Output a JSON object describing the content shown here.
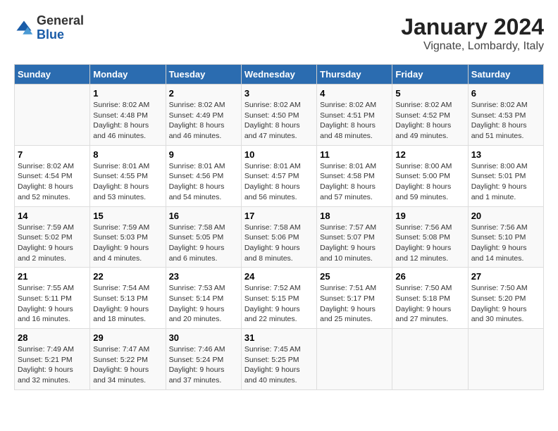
{
  "logo": {
    "general": "General",
    "blue": "Blue"
  },
  "title": "January 2024",
  "subtitle": "Vignate, Lombardy, Italy",
  "days_of_week": [
    "Sunday",
    "Monday",
    "Tuesday",
    "Wednesday",
    "Thursday",
    "Friday",
    "Saturday"
  ],
  "weeks": [
    [
      {
        "day": "",
        "info": ""
      },
      {
        "day": "1",
        "info": "Sunrise: 8:02 AM\nSunset: 4:48 PM\nDaylight: 8 hours\nand 46 minutes."
      },
      {
        "day": "2",
        "info": "Sunrise: 8:02 AM\nSunset: 4:49 PM\nDaylight: 8 hours\nand 46 minutes."
      },
      {
        "day": "3",
        "info": "Sunrise: 8:02 AM\nSunset: 4:50 PM\nDaylight: 8 hours\nand 47 minutes."
      },
      {
        "day": "4",
        "info": "Sunrise: 8:02 AM\nSunset: 4:51 PM\nDaylight: 8 hours\nand 48 minutes."
      },
      {
        "day": "5",
        "info": "Sunrise: 8:02 AM\nSunset: 4:52 PM\nDaylight: 8 hours\nand 49 minutes."
      },
      {
        "day": "6",
        "info": "Sunrise: 8:02 AM\nSunset: 4:53 PM\nDaylight: 8 hours\nand 51 minutes."
      }
    ],
    [
      {
        "day": "7",
        "info": "Sunrise: 8:02 AM\nSunset: 4:54 PM\nDaylight: 8 hours\nand 52 minutes."
      },
      {
        "day": "8",
        "info": "Sunrise: 8:01 AM\nSunset: 4:55 PM\nDaylight: 8 hours\nand 53 minutes."
      },
      {
        "day": "9",
        "info": "Sunrise: 8:01 AM\nSunset: 4:56 PM\nDaylight: 8 hours\nand 54 minutes."
      },
      {
        "day": "10",
        "info": "Sunrise: 8:01 AM\nSunset: 4:57 PM\nDaylight: 8 hours\nand 56 minutes."
      },
      {
        "day": "11",
        "info": "Sunrise: 8:01 AM\nSunset: 4:58 PM\nDaylight: 8 hours\nand 57 minutes."
      },
      {
        "day": "12",
        "info": "Sunrise: 8:00 AM\nSunset: 5:00 PM\nDaylight: 8 hours\nand 59 minutes."
      },
      {
        "day": "13",
        "info": "Sunrise: 8:00 AM\nSunset: 5:01 PM\nDaylight: 9 hours\nand 1 minute."
      }
    ],
    [
      {
        "day": "14",
        "info": "Sunrise: 7:59 AM\nSunset: 5:02 PM\nDaylight: 9 hours\nand 2 minutes."
      },
      {
        "day": "15",
        "info": "Sunrise: 7:59 AM\nSunset: 5:03 PM\nDaylight: 9 hours\nand 4 minutes."
      },
      {
        "day": "16",
        "info": "Sunrise: 7:58 AM\nSunset: 5:05 PM\nDaylight: 9 hours\nand 6 minutes."
      },
      {
        "day": "17",
        "info": "Sunrise: 7:58 AM\nSunset: 5:06 PM\nDaylight: 9 hours\nand 8 minutes."
      },
      {
        "day": "18",
        "info": "Sunrise: 7:57 AM\nSunset: 5:07 PM\nDaylight: 9 hours\nand 10 minutes."
      },
      {
        "day": "19",
        "info": "Sunrise: 7:56 AM\nSunset: 5:08 PM\nDaylight: 9 hours\nand 12 minutes."
      },
      {
        "day": "20",
        "info": "Sunrise: 7:56 AM\nSunset: 5:10 PM\nDaylight: 9 hours\nand 14 minutes."
      }
    ],
    [
      {
        "day": "21",
        "info": "Sunrise: 7:55 AM\nSunset: 5:11 PM\nDaylight: 9 hours\nand 16 minutes."
      },
      {
        "day": "22",
        "info": "Sunrise: 7:54 AM\nSunset: 5:13 PM\nDaylight: 9 hours\nand 18 minutes."
      },
      {
        "day": "23",
        "info": "Sunrise: 7:53 AM\nSunset: 5:14 PM\nDaylight: 9 hours\nand 20 minutes."
      },
      {
        "day": "24",
        "info": "Sunrise: 7:52 AM\nSunset: 5:15 PM\nDaylight: 9 hours\nand 22 minutes."
      },
      {
        "day": "25",
        "info": "Sunrise: 7:51 AM\nSunset: 5:17 PM\nDaylight: 9 hours\nand 25 minutes."
      },
      {
        "day": "26",
        "info": "Sunrise: 7:50 AM\nSunset: 5:18 PM\nDaylight: 9 hours\nand 27 minutes."
      },
      {
        "day": "27",
        "info": "Sunrise: 7:50 AM\nSunset: 5:20 PM\nDaylight: 9 hours\nand 30 minutes."
      }
    ],
    [
      {
        "day": "28",
        "info": "Sunrise: 7:49 AM\nSunset: 5:21 PM\nDaylight: 9 hours\nand 32 minutes."
      },
      {
        "day": "29",
        "info": "Sunrise: 7:47 AM\nSunset: 5:22 PM\nDaylight: 9 hours\nand 34 minutes."
      },
      {
        "day": "30",
        "info": "Sunrise: 7:46 AM\nSunset: 5:24 PM\nDaylight: 9 hours\nand 37 minutes."
      },
      {
        "day": "31",
        "info": "Sunrise: 7:45 AM\nSunset: 5:25 PM\nDaylight: 9 hours\nand 40 minutes."
      },
      {
        "day": "",
        "info": ""
      },
      {
        "day": "",
        "info": ""
      },
      {
        "day": "",
        "info": ""
      }
    ]
  ]
}
